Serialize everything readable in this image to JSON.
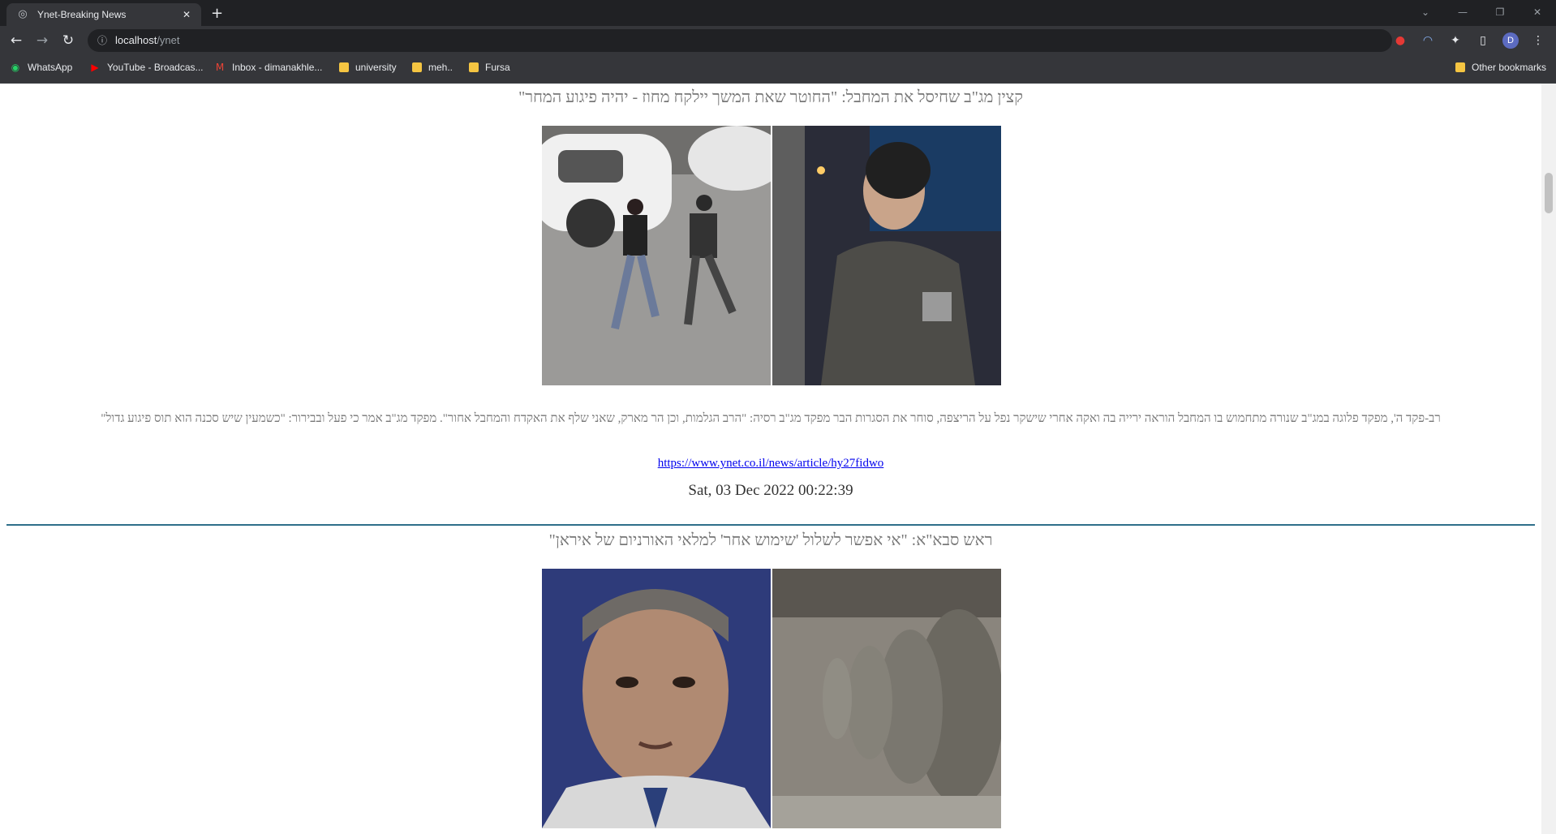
{
  "browser": {
    "tab_title": "Ynet-Breaking News",
    "tab_close": "✕",
    "new_tab": "+",
    "url_host": "localhost",
    "url_path": "/ynet",
    "bookmarks": [
      {
        "label": "WhatsApp",
        "icon": "whatsapp-icon"
      },
      {
        "label": "YouTube - Broadcas...",
        "icon": "youtube-icon"
      },
      {
        "label": "Inbox - dimanakhle...",
        "icon": "gmail-icon"
      },
      {
        "label": "university",
        "icon": "folder-icon"
      },
      {
        "label": "meh..",
        "icon": "folder-icon"
      },
      {
        "label": "Fursa",
        "icon": "folder-icon"
      }
    ],
    "other_bookmarks": "Other bookmarks",
    "profile_initial": "D"
  },
  "articles": [
    {
      "headline": "קצין מג\"ב שחיסל את המחבל: \"החוטר שאת המשך יילקח מחוז - יהיה פיגוע המחר\"",
      "summary": "רב-פקד ה', מפקד פלוגה במג\"ב שנורה מתחמוש בו המחבל הוראה ירייה בה ואקה אחרי שישקר נפל על הריצפה, סוחר את הסגרות הבר מפקד מג\"ב רסיה: \"הרב הגלמות, וכן הר מארק, שאני שלף את האקדח והמחבל אחור\". מפקד מג\"ב אמר כי פעל ובבירור: \"כשמעין שיש סכנה הוא תוס פיגוע גדול\"",
      "link": "https://www.ynet.co.il/news/article/hy27fidwo",
      "date": "Sat, 03 Dec 2022 00:22:39"
    },
    {
      "headline": "ראש סבא\"א: \"אי אפשר לשלול 'שימוש אחר' למלאי האורניום של איראן\""
    }
  ]
}
